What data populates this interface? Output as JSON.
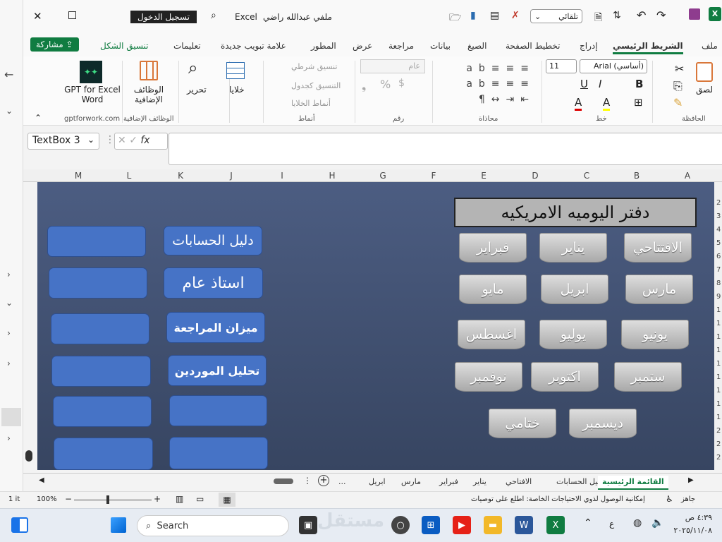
{
  "title": {
    "file": "ملفي عبدالله راضي",
    "app": "Excel",
    "signin": "تسجيل الدخول",
    "autosave": "تلقائي"
  },
  "tabs": [
    "ملف",
    "الشريط الرئيسي",
    "إدراج",
    "تخطيط الصفحة",
    "الصيغ",
    "بيانات",
    "مراجعة",
    "عرض",
    "المطور",
    "علامة تبويب جديدة",
    "تعليمات",
    "تنسيق الشكل"
  ],
  "share": "مشاركة",
  "ribbon": {
    "paste": "لصق",
    "clipboard": "الحافظة",
    "font_name": "Arial (أساسي)",
    "font_size": "11",
    "font": "خط",
    "alignment": "محاذاة",
    "number_format": "عام",
    "number": "رقم",
    "cond_format": "تنسيق شرطي",
    "format_table": "التنسيق كجدول",
    "cell_styles": "أنماط الخلايا",
    "styles": "أنماط",
    "cells": "خلايا",
    "editing": "تحرير",
    "addins": "الوظائف الإضافية",
    "addins_group": "الوظائف الإضافية",
    "gpt": "GPT for Excel Word",
    "gpt_group": "gptforwork.com",
    "bold": "B",
    "italic": "I",
    "underline": "U",
    "font_color": "A",
    "highlight": "A"
  },
  "namebox": "TextBox 3",
  "fx": "fx",
  "columns": [
    "M",
    "L",
    "K",
    "J",
    "I",
    "H",
    "G",
    "F",
    "E",
    "D",
    "C",
    "B",
    "A"
  ],
  "rows": [
    "2",
    "3",
    "4",
    "5",
    "6",
    "7",
    "8",
    "9",
    "1",
    "1",
    "1",
    "1",
    "1",
    "1",
    "1",
    "1",
    "1",
    "2",
    "2",
    "2"
  ],
  "sheet": {
    "header": "دفتر اليوميه الامريكيه",
    "months": [
      "الافتتاحي",
      "يناير",
      "فبراير",
      "مارس",
      "ابريل",
      "مايو",
      "يونيو",
      "يوليو",
      "اغسطس",
      "ستمبر",
      "اكتوبر",
      "نوفمبر",
      "ديسمبر",
      "ختامي"
    ],
    "links": [
      "دليل الحسابات",
      "استاذ عام",
      "ميزان المراجعة",
      "تحليل الموردين"
    ]
  },
  "sheet_tabs": [
    "القائمة الرئيسية",
    "دليل الحسابات",
    "الافتاحي",
    "يناير",
    "فبراير",
    "مارس",
    "ابريل",
    "..."
  ],
  "status": {
    "ready": "جاهز",
    "accessibility": "إمكانية الوصول لذوي الاحتياجات الخاصة: اطلع على توصيات",
    "zoom": "100%",
    "left_count": "1 it"
  },
  "taskbar": {
    "search": "Search",
    "time": "٤:٣٩ ص",
    "date": "٢٠٢٥/١١/٠٨",
    "lang": "ع",
    "watermark": "مستقل"
  },
  "colors": {
    "excel_green": "#107c41",
    "sheet_bg": "#44557a",
    "button_blue": "#4673c6"
  }
}
